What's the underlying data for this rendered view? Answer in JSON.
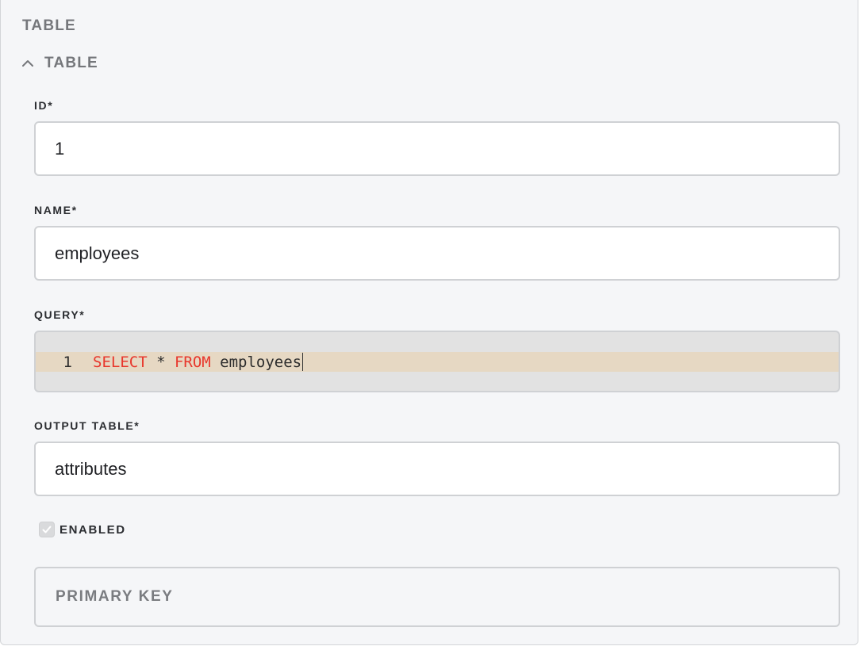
{
  "section": {
    "title": "TABLE",
    "collapse_label": "TABLE",
    "collapse_icon": "chevron-up-icon"
  },
  "fields": {
    "id": {
      "label": "ID*",
      "value": "1"
    },
    "name": {
      "label": "NAME*",
      "value": "employees"
    },
    "query": {
      "label": "QUERY*",
      "line_number": "1",
      "tokens": {
        "select": "SELECT",
        "star": " * ",
        "from": "FROM",
        "table": " employees"
      }
    },
    "output_table": {
      "label": "OUTPUT TABLE*",
      "value": "attributes"
    },
    "enabled": {
      "label": "ENABLED",
      "checked": true
    },
    "primary_key": {
      "label": "PRIMARY KEY"
    }
  },
  "colors": {
    "keyword": "#e8372c",
    "active_line": "#e6d8c3",
    "editor_bg": "#e2e2e2",
    "panel_bg": "#f5f6f8"
  }
}
